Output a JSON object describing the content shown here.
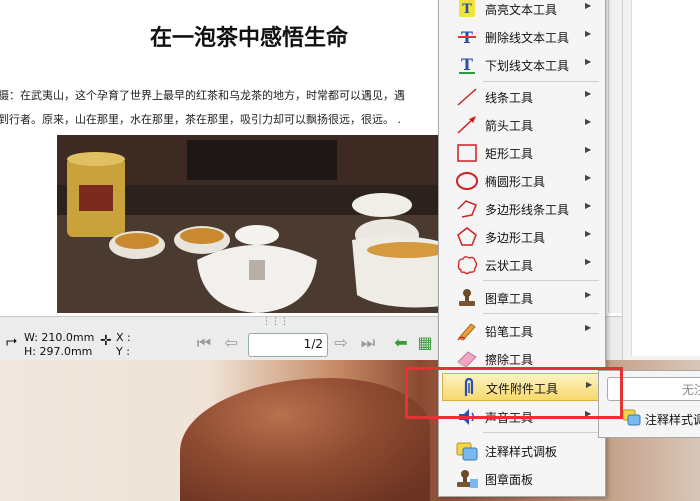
{
  "document": {
    "title": "在一泡茶中感悟生命",
    "line1": "摄：在武夷山，这个孕育了世界上最早的红茶和乌龙茶的地方，时常都可以遇见，遇",
    "line2": "到行者。原来，山在那里，水在那里，茶在那里，吸引力却可以飘扬很远，很远。 ."
  },
  "status_bar": {
    "width_label": "W: 210.0mm",
    "height_label": "H: 297.0mm",
    "x_label": "X :",
    "y_label": "Y :",
    "page_input": "1",
    "page_total": "/2"
  },
  "menu": {
    "items": [
      {
        "label": "高亮文本工具",
        "icon": "highlight-text-icon",
        "sub": true
      },
      {
        "label": "删除线文本工具",
        "icon": "strikethrough-text-icon",
        "sub": true
      },
      {
        "label": "下划线文本工具",
        "icon": "underline-text-icon",
        "sub": true
      },
      {
        "label": "线条工具",
        "icon": "line-icon",
        "sub": true
      },
      {
        "label": "箭头工具",
        "icon": "arrow-icon",
        "sub": true
      },
      {
        "label": "矩形工具",
        "icon": "rectangle-icon",
        "sub": true
      },
      {
        "label": "椭圆形工具",
        "icon": "ellipse-icon",
        "sub": true
      },
      {
        "label": "多边形线条工具",
        "icon": "polyline-icon",
        "sub": true
      },
      {
        "label": "多边形工具",
        "icon": "polygon-icon",
        "sub": true
      },
      {
        "label": "云状工具",
        "icon": "cloud-icon",
        "sub": true
      },
      {
        "label": "图章工具",
        "icon": "stamp-icon",
        "sub": true
      },
      {
        "label": "铅笔工具",
        "icon": "pencil-icon",
        "sub": true
      },
      {
        "label": "擦除工具",
        "icon": "eraser-icon",
        "sub": false
      },
      {
        "label": "文件附件工具",
        "icon": "paperclip-icon",
        "sub": true
      },
      {
        "label": "声音工具",
        "icon": "sound-icon",
        "sub": true
      },
      {
        "label": "注释样式调板",
        "icon": "annotation-style-icon",
        "sub": false
      },
      {
        "label": "图章面板",
        "icon": "stamp-panel-icon",
        "sub": false
      }
    ]
  },
  "submenu": {
    "input_placeholder": "无注",
    "item_label": "注释样式调"
  },
  "colors": {
    "highlight": "#f7d96a",
    "callout": "#e53232"
  }
}
